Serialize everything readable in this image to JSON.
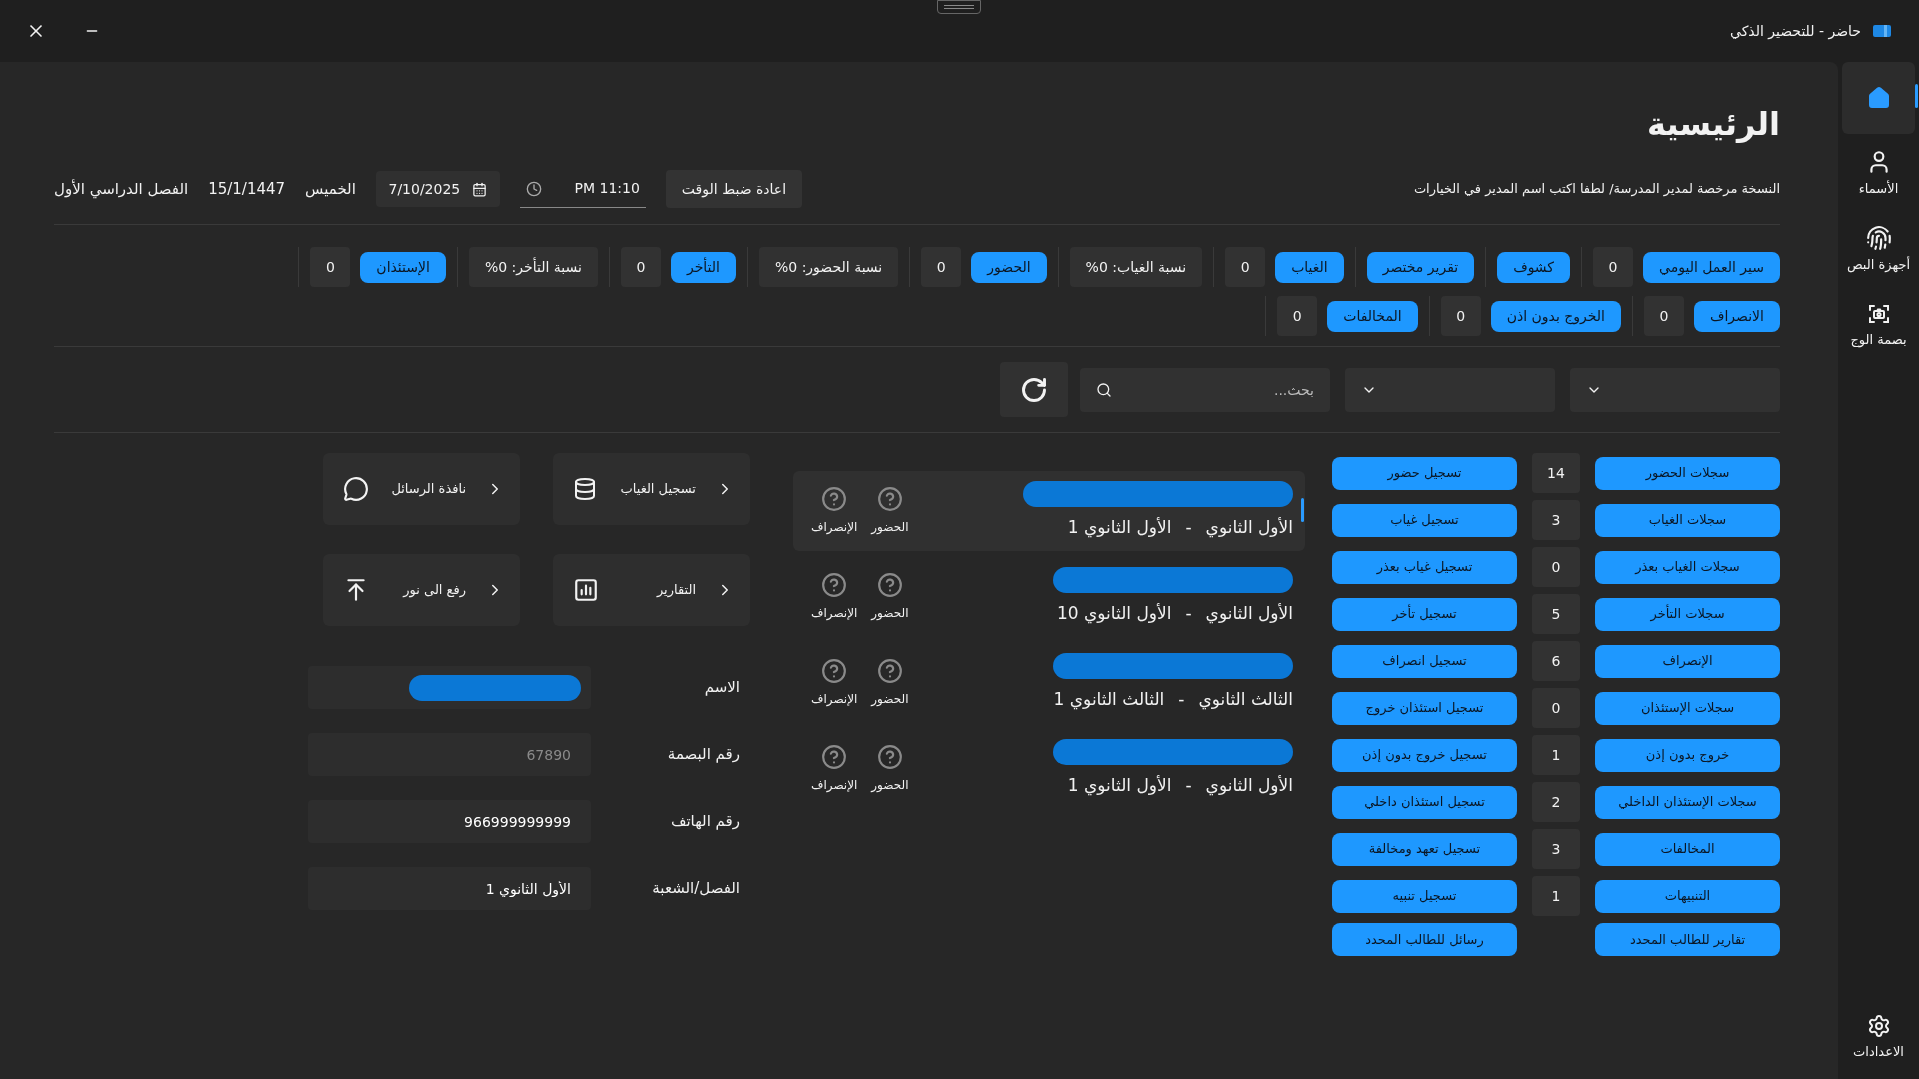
{
  "window": {
    "title": "حاضر - للتحضير الذكي"
  },
  "nav": [
    {
      "kind": "home",
      "selected": true
    },
    {
      "kind": "names",
      "label": "الأسماء",
      "selected": false
    },
    {
      "kind": "fingerprint",
      "label": "أجهزة البص",
      "selected": false
    },
    {
      "kind": "face",
      "label": "بصمة الوج",
      "selected": false
    }
  ],
  "settings": {
    "label": "الاعدادات"
  },
  "page": {
    "title": "الرئيسية",
    "notice": "النسخة مرخصة لمدير المدرسة/ لطفا اكتب اسم المدير في الخيارات"
  },
  "header": {
    "reset_button": "اعادة ضبط الوقت",
    "time": "PM 11:10",
    "date": "7/10/2025",
    "weekday": "الخميس",
    "hijri_date": "15/1/1447",
    "semester": "الفصل الدراسي الأول"
  },
  "stats": [
    [
      [
        {
          "kind": "button",
          "text": "سير العمل اليومي"
        },
        {
          "kind": "count",
          "text": "0"
        }
      ],
      [
        {
          "kind": "button",
          "text": "كشوف"
        }
      ],
      [
        {
          "kind": "button",
          "text": "تقرير مختصر"
        }
      ],
      [
        {
          "kind": "button",
          "text": "الغياب"
        },
        {
          "kind": "count",
          "text": "0"
        }
      ],
      [
        {
          "kind": "ratio",
          "text": "نسبة الغياب: 0%"
        }
      ],
      [
        {
          "kind": "button",
          "text": "الحضور"
        },
        {
          "kind": "count",
          "text": "0"
        }
      ],
      [
        {
          "kind": "ratio",
          "text": "نسبة الحضور: 0%"
        }
      ],
      [
        {
          "kind": "button",
          "text": "التأخر"
        },
        {
          "kind": "count",
          "text": "0"
        }
      ],
      [
        {
          "kind": "ratio",
          "text": "نسبة التأخر: 0%"
        }
      ],
      [
        {
          "kind": "button",
          "text": "الإستئذان"
        },
        {
          "kind": "count",
          "text": "0"
        }
      ]
    ],
    [
      [
        {
          "kind": "button",
          "text": "الانصراف"
        },
        {
          "kind": "count",
          "text": "0"
        }
      ],
      [
        {
          "kind": "button",
          "text": "الخروج بدون اذن"
        },
        {
          "kind": "count",
          "text": "0"
        }
      ],
      [
        {
          "kind": "button",
          "text": "المخالفات"
        },
        {
          "kind": "count",
          "text": "0"
        }
      ]
    ]
  ],
  "search": {
    "placeholder": "بحث..."
  },
  "records": [
    {
      "records": "سجلات الحضور",
      "count": "14",
      "register": "تسجيل حضور"
    },
    {
      "records": "سجلات الغياب",
      "count": "3",
      "register": "تسجيل غياب"
    },
    {
      "records": "سجلات الغياب بعذر",
      "count": "0",
      "register": "تسجيل غياب بعذر"
    },
    {
      "records": "سجلات التأخر",
      "count": "5",
      "register": "تسجيل تأخر"
    },
    {
      "records": "الإنصراف",
      "count": "6",
      "register": "تسجيل انصراف"
    },
    {
      "records": "سجلات الإستئذان",
      "count": "0",
      "register": "تسجيل استئذان خروج"
    },
    {
      "records": "خروج بدون إذن",
      "count": "1",
      "register": "تسجيل خروج بدون إذن"
    },
    {
      "records": "سجلات الإستئذان الداخلي",
      "count": "2",
      "register": "تسجيل استئذان داخلي"
    },
    {
      "records": "المخالفات",
      "count": "3",
      "register": "تسجيل تعهد ومخالفة"
    },
    {
      "records": "التنبيهات",
      "count": "1",
      "register": "تسجيل تنبيه"
    },
    {
      "records": "تقارير للطالب المحدد",
      "register": "رسائل للطالب المحدد"
    }
  ],
  "students": [
    {
      "grade": "الأول الثانوي",
      "separator": "-",
      "section": "الأول الثانوي 1",
      "selected": true,
      "statuses": [
        "الحضور",
        "الإنصراف"
      ]
    },
    {
      "grade": "الأول الثانوي",
      "separator": "-",
      "section": "الأول الثانوي 10",
      "selected": false,
      "statuses": [
        "الحضور",
        "الإنصراف"
      ]
    },
    {
      "grade": "الثالث الثانوي",
      "separator": "-",
      "section": "الثالث الثانوي 1",
      "selected": false,
      "statuses": [
        "الحضور",
        "الإنصراف"
      ]
    },
    {
      "grade": "الأول الثانوي",
      "separator": "-",
      "section": "الأول الثانوي 1",
      "selected": false,
      "statuses": [
        "الحضور",
        "الإنصراف"
      ]
    }
  ],
  "tiles": [
    {
      "kind": "database",
      "label": "تسجيل الغياب"
    },
    {
      "kind": "messages",
      "label": "نافذة الرسائل"
    },
    {
      "kind": "reports",
      "label": "التقارير"
    },
    {
      "kind": "upload",
      "label": "رفع الى نور"
    }
  ],
  "form": [
    {
      "label": "الاسم",
      "kind": "redacted"
    },
    {
      "label": "رقم البصمة",
      "kind": "text",
      "value": "67890",
      "disabled": true
    },
    {
      "label": "رقم الهاتف",
      "kind": "text",
      "value": "966999999999",
      "disabled": false
    },
    {
      "label": "الفصل/الشعبة",
      "kind": "text",
      "value": "الأول الثانوي 1",
      "disabled": false
    }
  ]
}
